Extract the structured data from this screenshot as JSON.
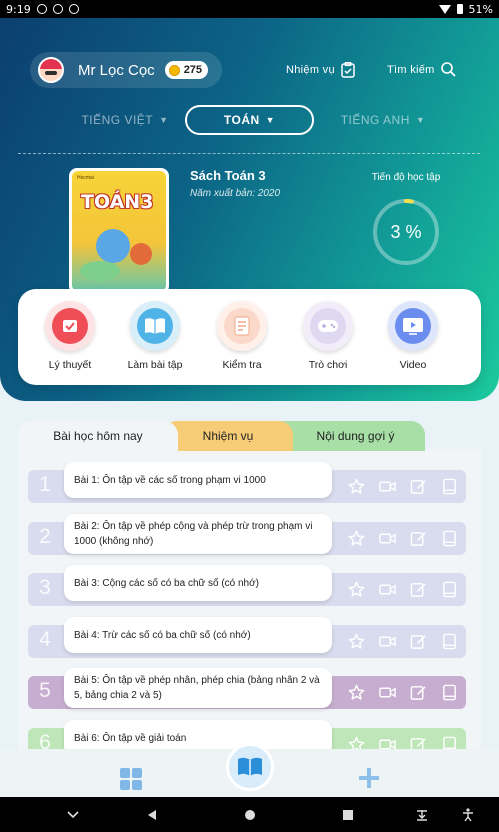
{
  "status_bar": {
    "time": "9:19",
    "battery": "51%"
  },
  "header": {
    "username": "Mr Lọc Cọc",
    "coins": "275",
    "missions_label": "Nhiệm vụ",
    "search_label": "Tìm kiếm"
  },
  "subjects": [
    {
      "label": "TIẾNG VIỆT",
      "active": false
    },
    {
      "label": "TOÁN",
      "active": true
    },
    {
      "label": "TIẾNG ANH",
      "active": false
    }
  ],
  "book": {
    "cover_publisher": "Hocmai",
    "cover_title": "TOÁN3",
    "title": "Sách Toán 3",
    "year": "Năm xuất bản: 2020",
    "progress_label": "Tiến độ học tập",
    "progress_text": "3 %",
    "progress_fraction": 0.03
  },
  "features": [
    {
      "label": "Lý thuyết",
      "icon": "theory-icon"
    },
    {
      "label": "Làm bài tập",
      "icon": "exercise-book-icon"
    },
    {
      "label": "Kiểm tra",
      "icon": "test-paper-icon"
    },
    {
      "label": "Trò chơi",
      "icon": "gamepad-icon"
    },
    {
      "label": "Video",
      "icon": "video-tv-icon"
    }
  ],
  "tabs": [
    {
      "label": "Bài học hôm nay"
    },
    {
      "label": "Nhiệm vụ"
    },
    {
      "label": "Nội dung gợi ý"
    }
  ],
  "lessons": [
    {
      "num": "1",
      "title": "Bài 1: Ôn tập về các số trong phạm vi 1000",
      "color": "#d9dcee"
    },
    {
      "num": "2",
      "title": "Bài 2: Ôn tập về phép cộng và phép trừ trong phạm vi 1000 (không nhớ)",
      "color": "#d9dcee"
    },
    {
      "num": "3",
      "title": "Bài 3: Cộng các số có ba chữ số (có nhớ)",
      "color": "#d9dcee"
    },
    {
      "num": "4",
      "title": "Bài 4: Trừ các số có ba chữ số (có nhớ)",
      "color": "#d9dcee"
    },
    {
      "num": "5",
      "title": "Bài 5: Ôn tập về phép nhân, phép chia (bảng nhân 2 và 5, bảng chia 2 và 5)",
      "color": "#c7aed0"
    },
    {
      "num": "6",
      "title": "Bài 6: Ôn tập về giải toán",
      "color": "#bfe6b9"
    }
  ],
  "lesson_actions": [
    "star-icon",
    "video-camera-icon",
    "edit-icon",
    "book-icon"
  ],
  "colors": {
    "accent": "#12a098",
    "dark_blue": "#0b3f70"
  }
}
